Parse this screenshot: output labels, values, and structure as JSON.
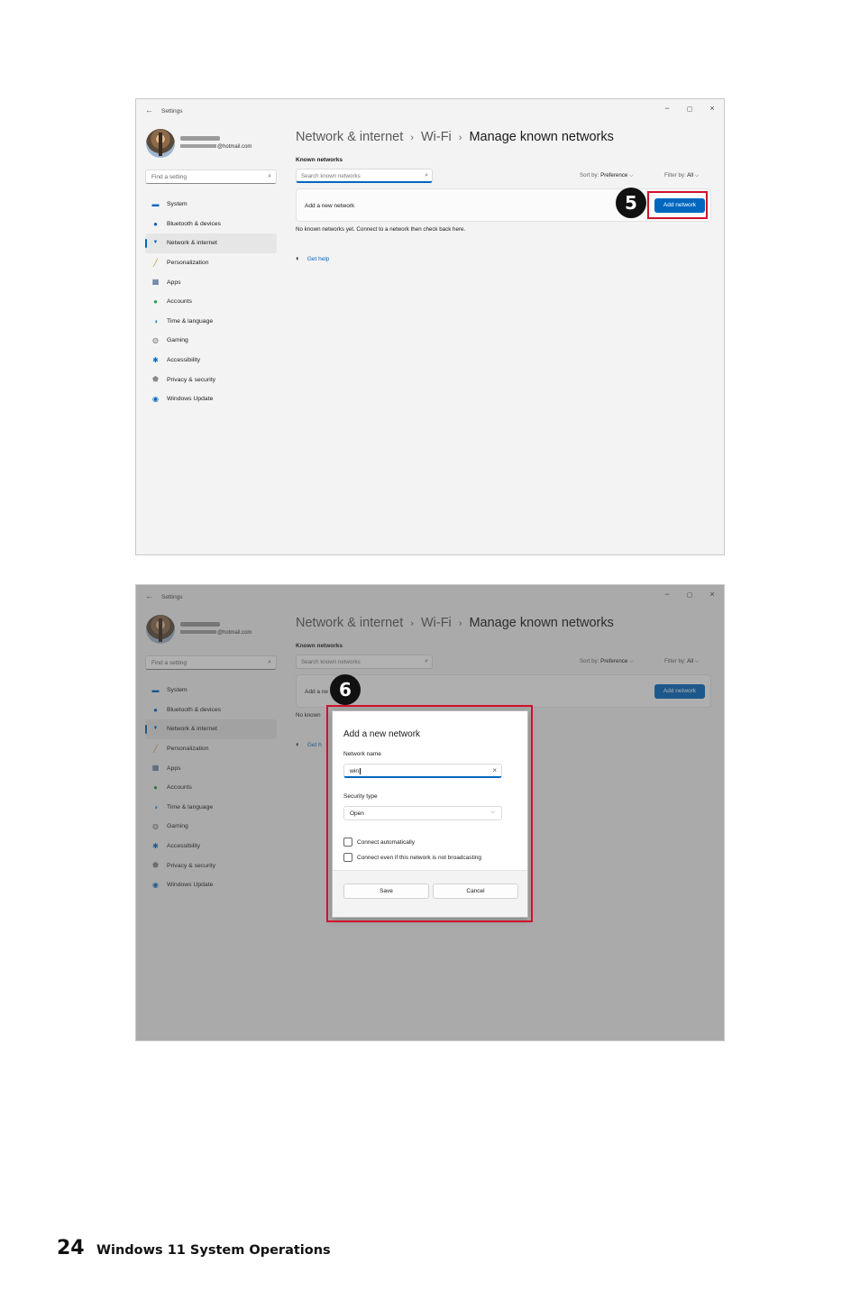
{
  "settings": {
    "back_icon": "←",
    "title": "Settings",
    "win_min": "−",
    "win_max": "▢",
    "win_close": "×",
    "email_suffix": "@hotmail.com",
    "find_placeholder": "Find a setting",
    "search_icon": "⌕",
    "nav": [
      {
        "label": "System",
        "icon": "system-icon",
        "glyph": "▬",
        "color": "#0067c0"
      },
      {
        "label": "Bluetooth & devices",
        "icon": "bluetooth-icon",
        "glyph": "●",
        "color": "#0067c0"
      },
      {
        "label": "Network & internet",
        "icon": "wifi-icon",
        "glyph": "▼",
        "color": "#0067c0"
      },
      {
        "label": "Personalization",
        "icon": "brush-icon",
        "glyph": "╱",
        "color": "#c98a2a"
      },
      {
        "label": "Apps",
        "icon": "apps-icon",
        "glyph": "▦",
        "color": "#3a5a8a"
      },
      {
        "label": "Accounts",
        "icon": "accounts-icon",
        "glyph": "●",
        "color": "#2e9e4a"
      },
      {
        "label": "Time & language",
        "icon": "globe-icon",
        "glyph": "◑",
        "color": "#1a8ad4"
      },
      {
        "label": "Gaming",
        "icon": "gamepad-icon",
        "glyph": "◍",
        "color": "#777777"
      },
      {
        "label": "Accessibility",
        "icon": "accessibility-icon",
        "glyph": "✱",
        "color": "#0067c0"
      },
      {
        "label": "Privacy & security",
        "icon": "shield-icon",
        "glyph": "⬟",
        "color": "#8a8a8a"
      },
      {
        "label": "Windows Update",
        "icon": "update-icon",
        "glyph": "◉",
        "color": "#0067c0"
      }
    ],
    "breadcrumb": {
      "part1": "Network & internet",
      "sep": "›",
      "part2": "Wi-Fi",
      "current": "Manage known networks"
    },
    "known_heading": "Known networks",
    "search_known_placeholder": "Search known networks",
    "sort_label": "Sort by:",
    "sort_value": "Preference",
    "filter_label": "Filter by:",
    "filter_value": "All",
    "chevron": "⌵",
    "add_row_label": "Add a new network",
    "add_button": "Add network",
    "no_known_text": "No known networks yet. Connect to a network then check back here.",
    "get_help": "Get help",
    "help_icon": "❓"
  },
  "shot2": {
    "add_row_label_partial": "Add a ne",
    "no_known_partial": "No known",
    "get_help_partial": "Get h"
  },
  "dialog": {
    "title": "Add a new network",
    "network_name_label": "Network name",
    "network_name_value": "win",
    "clear_icon": "×",
    "security_type_label": "Security type",
    "security_type_value": "Open",
    "connect_auto": "Connect automatically",
    "connect_broadcast": "Connect even if this network is not broadcasting",
    "save": "Save",
    "cancel": "Cancel"
  },
  "badges": {
    "step5": "5",
    "step6": "6"
  },
  "colors": {
    "accent": "#0067c0",
    "highlight": "#d0112b"
  },
  "footer": {
    "page_number": "24",
    "section_title": "Windows 11 System Operations"
  }
}
